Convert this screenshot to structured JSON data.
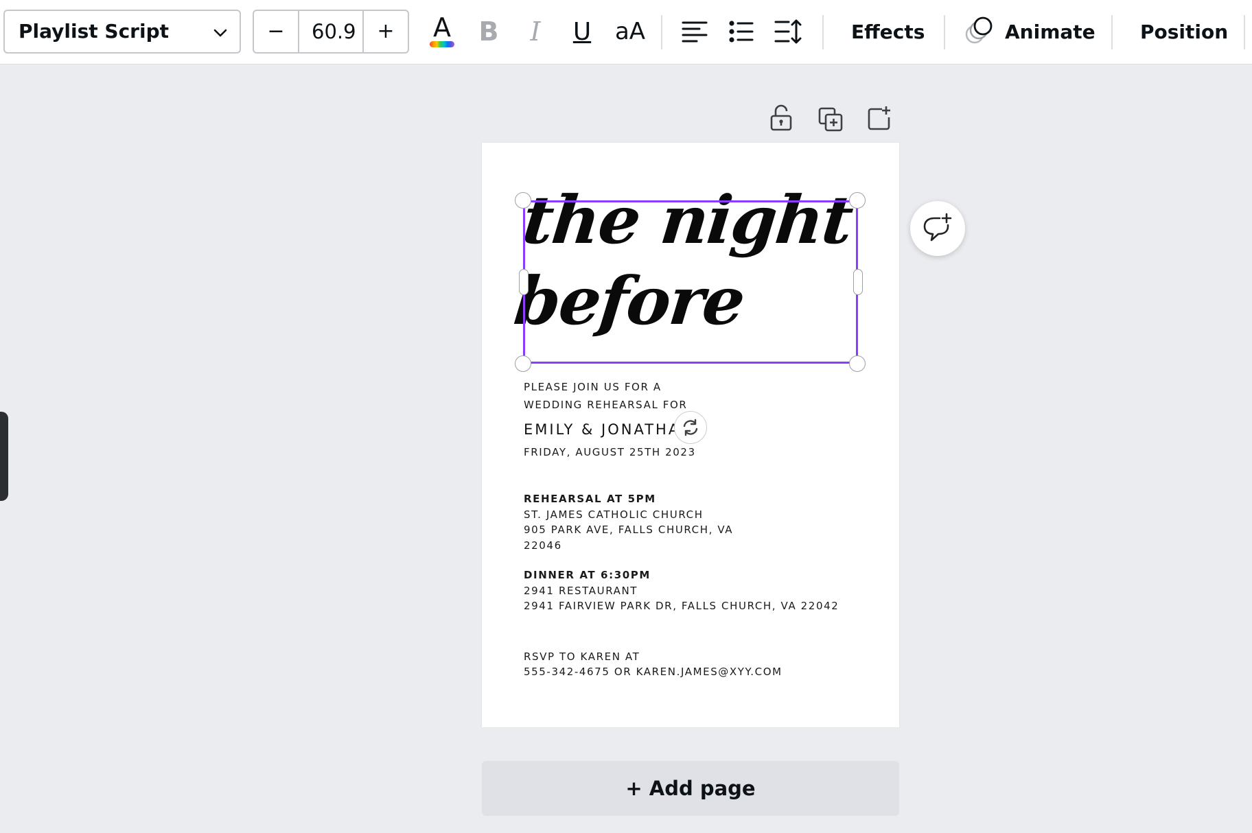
{
  "toolbar": {
    "font_name": "Playlist Script",
    "font_size_value": "60.9",
    "decrease_label": "−",
    "increase_label": "+",
    "text_color_glyph": "A",
    "bold_glyph": "B",
    "italic_glyph": "I",
    "underline_glyph": "U",
    "case_glyph": "aA",
    "effects_label": "Effects",
    "animate_label": "Animate",
    "position_label": "Position",
    "icons": [
      "chevron-down-icon",
      "text-color-icon",
      "align-left-icon",
      "list-icon",
      "spacing-icon",
      "animate-icon"
    ]
  },
  "page_actions": {
    "icons": [
      "lock-icon",
      "duplicate-icon",
      "add-page-icon"
    ]
  },
  "design": {
    "headline_line1": "the night",
    "headline_line2": "before",
    "intro_line1": "PLEASE JOIN US FOR A",
    "intro_line2": "WEDDING REHEARSAL FOR",
    "names": "EMILY & JONATHA",
    "date": "FRIDAY, AUGUST 25TH 2023",
    "rehearsal_heading": "REHEARSAL AT 5PM",
    "rehearsal_place": "ST. JAMES CATHOLIC CHURCH",
    "rehearsal_address1": "905 PARK AVE, FALLS CHURCH, VA",
    "rehearsal_address2": "22046",
    "dinner_heading": "DINNER AT 6:30PM",
    "dinner_place": "2941 RESTAURANT",
    "dinner_address": "2941 FAIRVIEW PARK DR, FALLS CHURCH, VA 22042",
    "rsvp_line1": "RSVP TO KAREN AT",
    "rsvp_line2": "555-342-4675 OR KAREN.JAMES@XYY.COM"
  },
  "add_page_label": "+ Add page",
  "colors": {
    "selection": "#8b3dff",
    "canvas_bg": "#ebecf0",
    "page_bg": "#ffffff"
  }
}
